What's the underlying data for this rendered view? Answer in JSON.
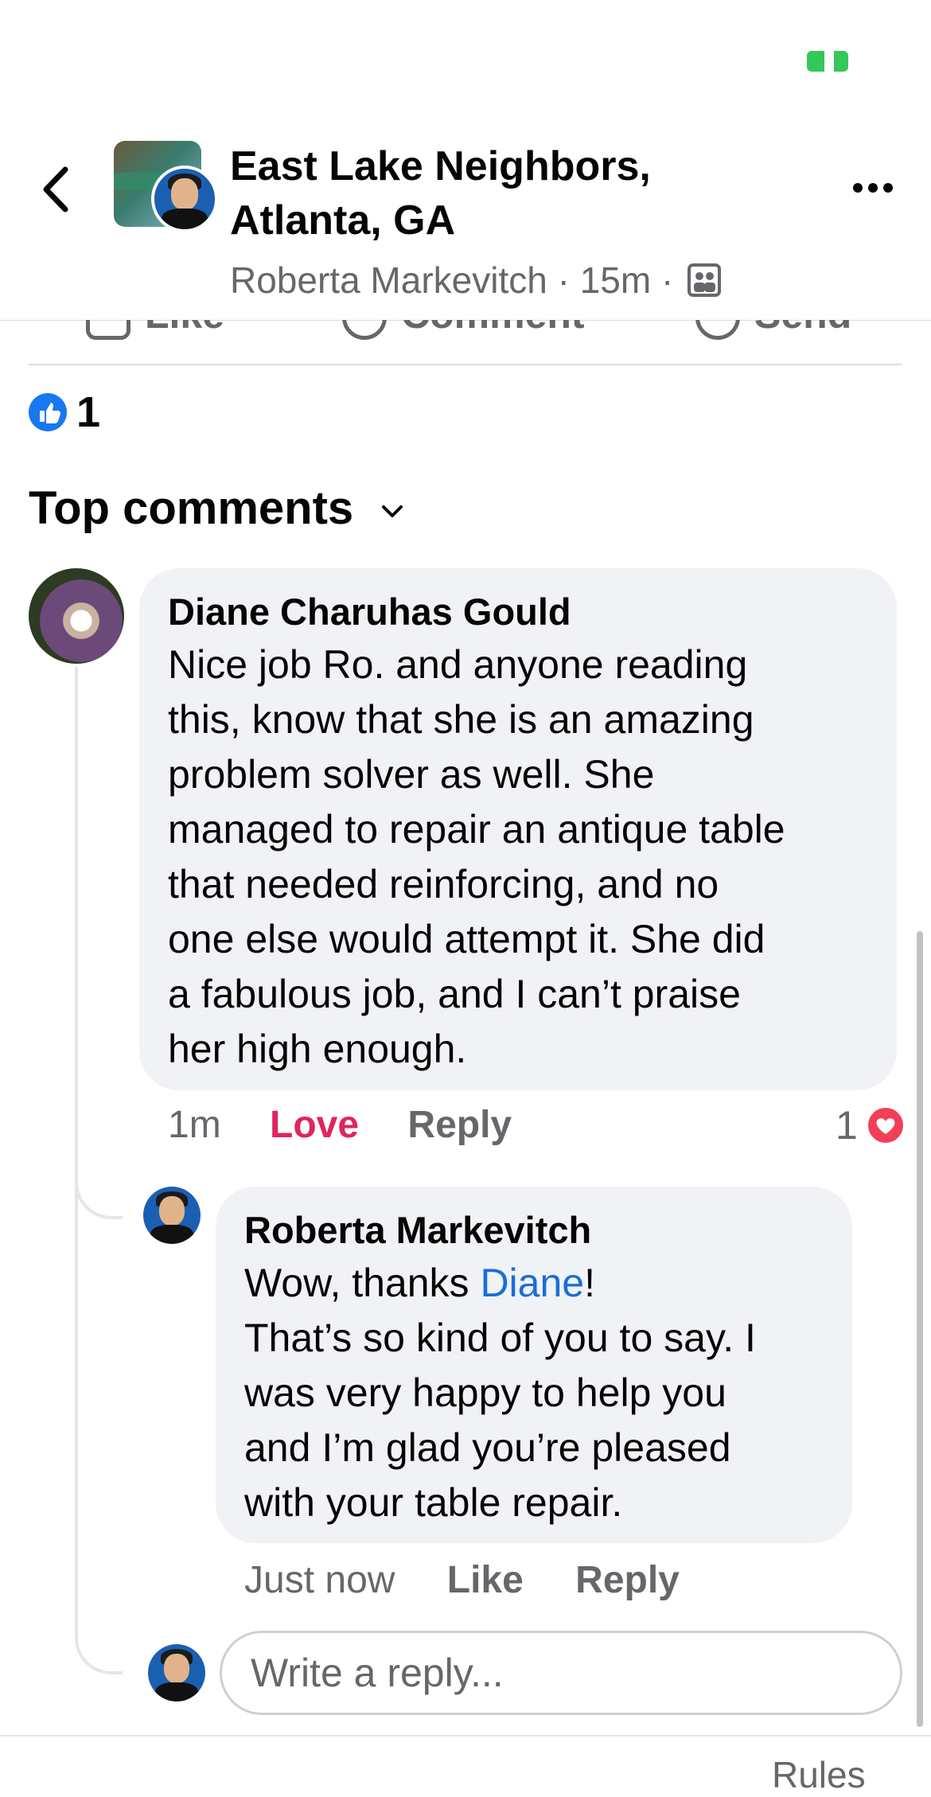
{
  "status_bar": {
    "battery_color": "#34c759"
  },
  "header": {
    "back_icon": "chevron-left-icon",
    "group_name": "East Lake Neighbors, Atlanta, GA",
    "author": "Roberta Markevitch",
    "separator": "·",
    "time": "15m",
    "audience_icon": "members-icon",
    "more_icon": "more-horizontal-icon"
  },
  "post_actions": [
    {
      "label": "Like",
      "icon": "thumbs-up-icon"
    },
    {
      "label": "Comment",
      "icon": "comment-icon"
    },
    {
      "label": "Send",
      "icon": "messenger-icon"
    }
  ],
  "reactions": {
    "count": "1",
    "icon": "like-reaction-icon"
  },
  "comments_header": {
    "label": "Top comments",
    "icon": "chevron-down-icon"
  },
  "comment": {
    "author": "Diane Charuhas Gould",
    "lines": [
      "Nice job Ro.  and anyone reading",
      "this, know that she is an amazing",
      "problem solver as well. She",
      "managed to repair an antique table",
      "that needed reinforcing, and no",
      "one else would attempt it. She did",
      "a fabulous job, and I can’t praise",
      "her high enough."
    ],
    "time": "1m",
    "love_label": "Love",
    "reply_label": "Reply",
    "reaction_count": "1",
    "reaction_icon": "love-reaction-icon"
  },
  "reply": {
    "author": "Roberta Markevitch",
    "greeting": "Wow, thanks ",
    "mention": "Diane",
    "greeting_end": "!",
    "lines": [
      "That’s so kind of you to say. I",
      "was very happy to help you",
      "and I’m glad you’re pleased",
      "with your table repair."
    ],
    "time": "Just now",
    "like_label": "Like",
    "reply_label": "Reply"
  },
  "reply_box": {
    "placeholder": "Write a reply..."
  },
  "footer": {
    "rules_label": "Rules"
  },
  "colors": {
    "love": "#e0245e",
    "link": "#1a6ed8",
    "like_blue": "#1877f2",
    "muted": "#65676b",
    "bubble": "#f0f2f5"
  }
}
